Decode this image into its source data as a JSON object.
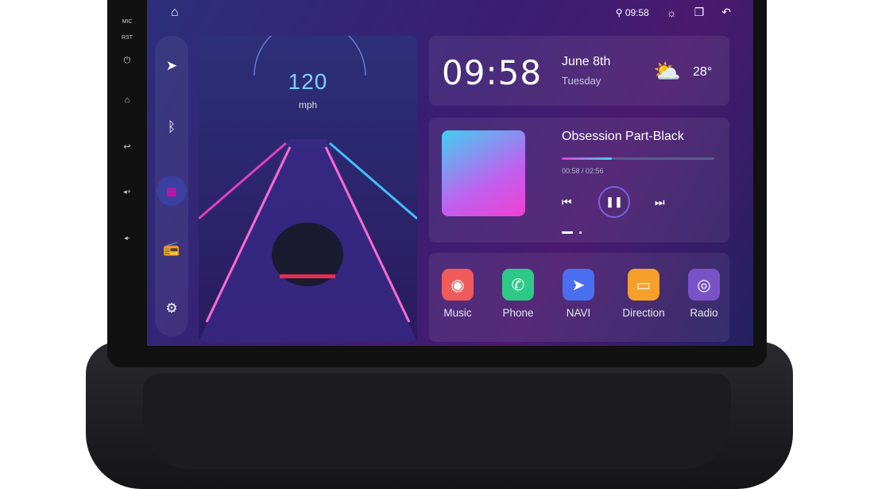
{
  "status_bar": {
    "time": "09:58"
  },
  "hardware_buttons": [
    "MIC",
    "RST",
    "⏻",
    "⌂",
    "↩",
    "◂+",
    "◂-"
  ],
  "speedometer": {
    "speed": "120",
    "unit": "mph"
  },
  "clock_widget": {
    "time": "09:58",
    "date": "June 8th",
    "weekday": "Tuesday",
    "temperature": "28°"
  },
  "music_widget": {
    "title": "Obsession Part-Black",
    "elapsed": "00:58",
    "duration": "02:56",
    "time_display": "00:58 / 02:56",
    "progress_percent": 33
  },
  "apps": [
    {
      "label": "Music",
      "color": "#ef5a5a"
    },
    {
      "label": "Phone",
      "color": "#2ec989"
    },
    {
      "label": "NAVI",
      "color": "#4a6ef0"
    },
    {
      "label": "Direction",
      "color": "#f5a02a"
    },
    {
      "label": "Radio",
      "color": "#7a52c8"
    }
  ]
}
